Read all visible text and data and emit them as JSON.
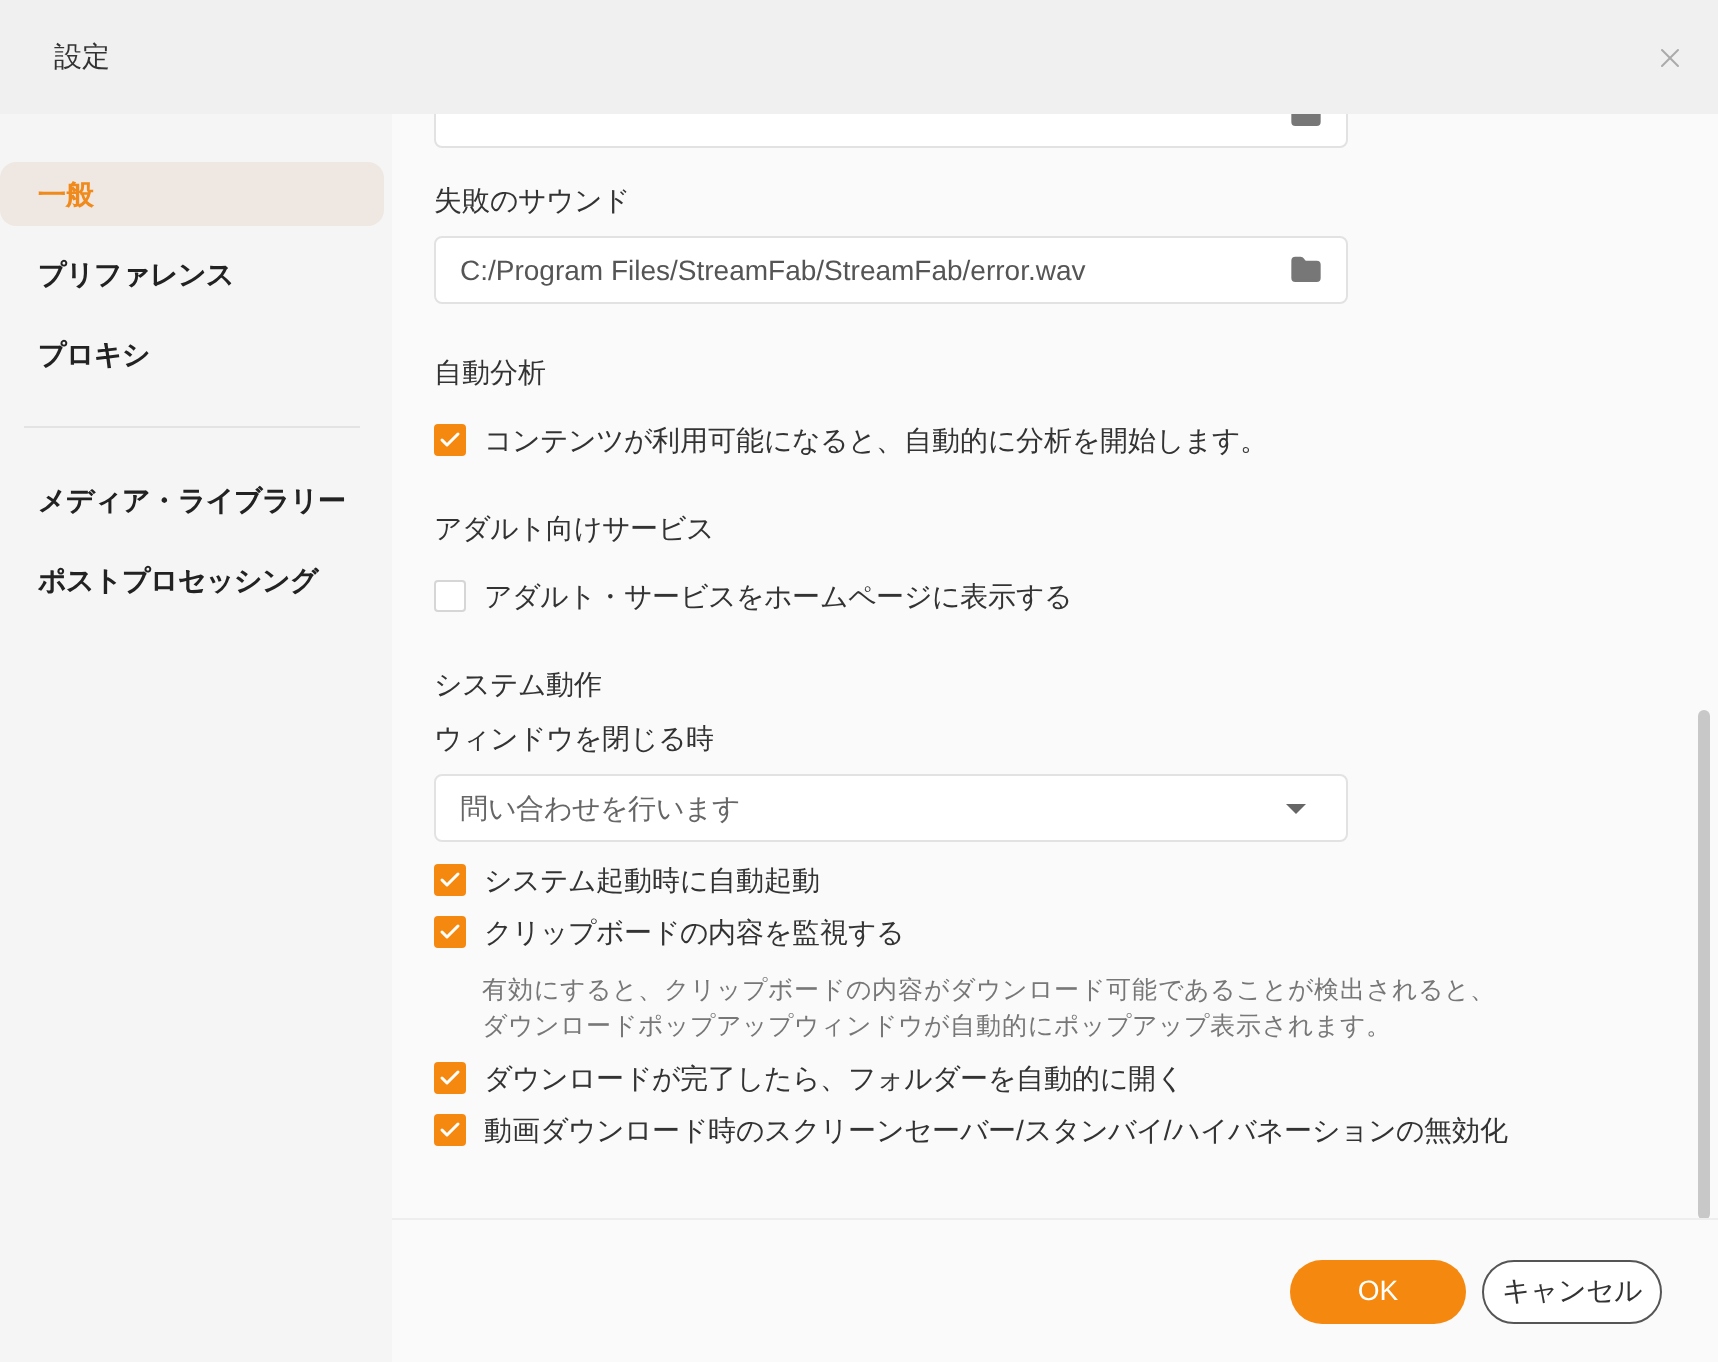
{
  "window": {
    "title": "設定"
  },
  "sidebar": {
    "groups": [
      [
        {
          "label": "一般",
          "selected": true
        },
        {
          "label": "プリファレンス",
          "selected": false
        },
        {
          "label": "プロキシ",
          "selected": false
        }
      ],
      [
        {
          "label": "メディア・ライブラリー",
          "selected": false
        },
        {
          "label": "ポストプロセッシング",
          "selected": false
        }
      ]
    ]
  },
  "content": [
    {
      "kind": "file"
    },
    {
      "kind": "file",
      "label": "失敗のサウンド",
      "value": "C:/Program Files/StreamFab/StreamFab/error.wav"
    },
    {
      "kind": "heading",
      "label": "自動分析"
    },
    {
      "kind": "checkbox",
      "label": "コンテンツが利用可能になると、自動的に分析を開始します。",
      "checked": true
    },
    {
      "kind": "heading",
      "label": "アダルト向けサービス"
    },
    {
      "kind": "checkbox",
      "label": "アダルト・サービスをホームページに表示する",
      "checked": false
    },
    {
      "kind": "heading",
      "label": "システム動作"
    },
    {
      "kind": "select",
      "label": "ウィンドウを閉じる時",
      "value": "問い合わせを行います"
    },
    {
      "kind": "checkbox",
      "label": "システム起動時に自動起動",
      "checked": true
    },
    {
      "kind": "checkbox",
      "label": "クリップボードの内容を監視する",
      "checked": true,
      "description": [
        "有効にすると、クリップボードの内容がダウンロード可能であることが検出されると、",
        "ダウンロードポップアップウィンドウが自動的にポップアップ表示されます。"
      ]
    },
    {
      "kind": "checkbox",
      "label": "ダウンロードが完了したら、フォルダーを自動的に開く",
      "checked": true
    },
    {
      "kind": "checkbox",
      "label": "動画ダウンロード時のスクリーンセーバー/スタンバイ/ハイバネーションの無効化",
      "checked": true
    }
  ],
  "buttons": [
    {
      "label": "OK",
      "kind": "primary"
    },
    {
      "label": "キャンセル",
      "kind": "secondary"
    }
  ]
}
